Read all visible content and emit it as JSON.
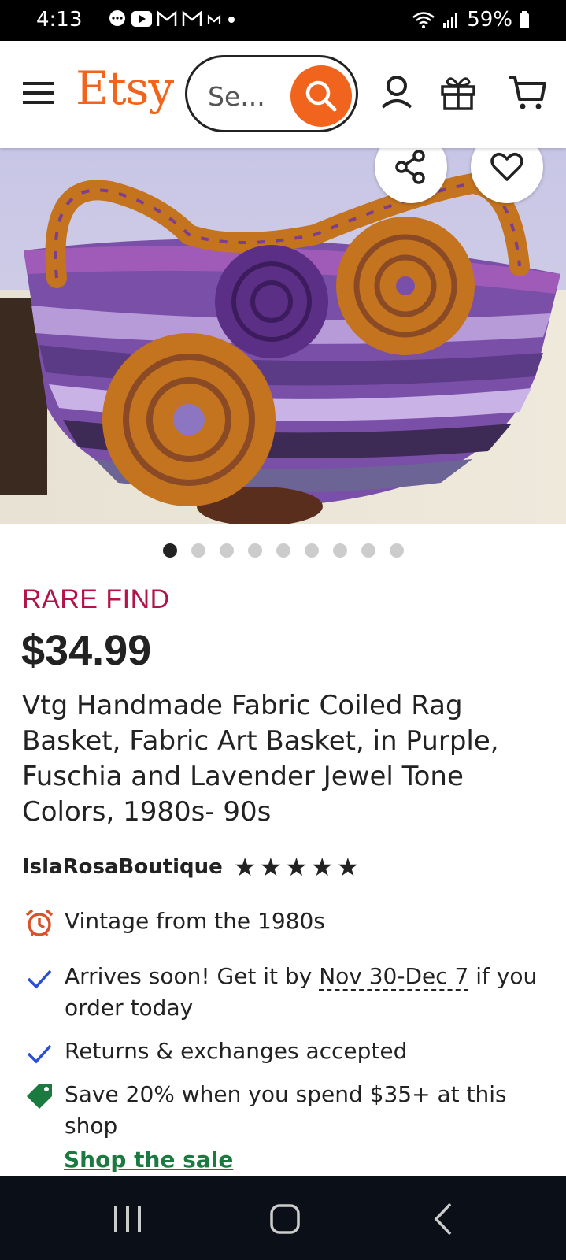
{
  "status": {
    "time": "4:13",
    "battery": "59%"
  },
  "header": {
    "logo": "Etsy",
    "search_placeholder": "Se..."
  },
  "carousel": {
    "total_images": 9,
    "active_index": 0
  },
  "listing": {
    "badge": "RARE FIND",
    "price": "$34.99",
    "title": "Vtg Handmade Fabric Coiled Rag Basket, Fabric Art Basket, in Purple, Fuschia and Lavender Jewel Tone Colors, 1980s- 90s",
    "shop_name": "IslaRosaBoutique",
    "rating_stars": 5
  },
  "features": {
    "vintage": "Vintage from the 1980s",
    "arrives_prefix": "Arrives soon! Get it by ",
    "arrives_date": "Nov 30-Dec 7",
    "arrives_suffix": " if you order today",
    "returns": "Returns & exchanges accepted",
    "sale": "Save 20% when you spend $35+ at this shop",
    "sale_link": "Shop the sale"
  },
  "colors": {
    "brand": "#f1641e",
    "rare": "#b3124a",
    "sale_green": "#1a7a3f"
  }
}
